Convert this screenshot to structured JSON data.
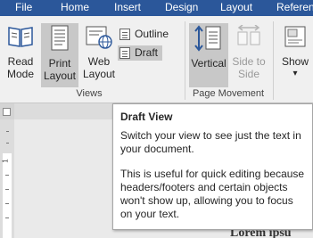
{
  "menu": {
    "tabs": [
      "File",
      "Home",
      "Insert",
      "Design",
      "Layout",
      "Referen"
    ]
  },
  "views_group": {
    "label": "Views",
    "read_mode": "Read Mode",
    "print_layout": "Print Layout",
    "web_layout": "Web Layout",
    "outline": "Outline",
    "draft": "Draft"
  },
  "page_movement_group": {
    "label": "Page Movement",
    "vertical": "Vertical",
    "side_to_side": "Side to Side"
  },
  "show_button": {
    "label": "Show",
    "arrow": "▾"
  },
  "tooltip": {
    "title": "Draft View",
    "paragraph1": "Switch your view to see just the text in your document.",
    "paragraph2": "This is useful for quick editing because headers/footers and certain objects won't show up, allowing you to focus on your text."
  },
  "ruler": {
    "vertical_mark": "1"
  },
  "document_peek": "Lorem ipsu",
  "colors": {
    "menubar": "#2b579a",
    "ribbon": "#f0f0f0",
    "active_button": "#c8c8c8"
  },
  "icons": [
    "read-mode-icon",
    "print-layout-icon",
    "web-layout-icon",
    "outline-icon",
    "draft-icon",
    "vertical-icon",
    "side-to-side-icon",
    "show-icon"
  ]
}
